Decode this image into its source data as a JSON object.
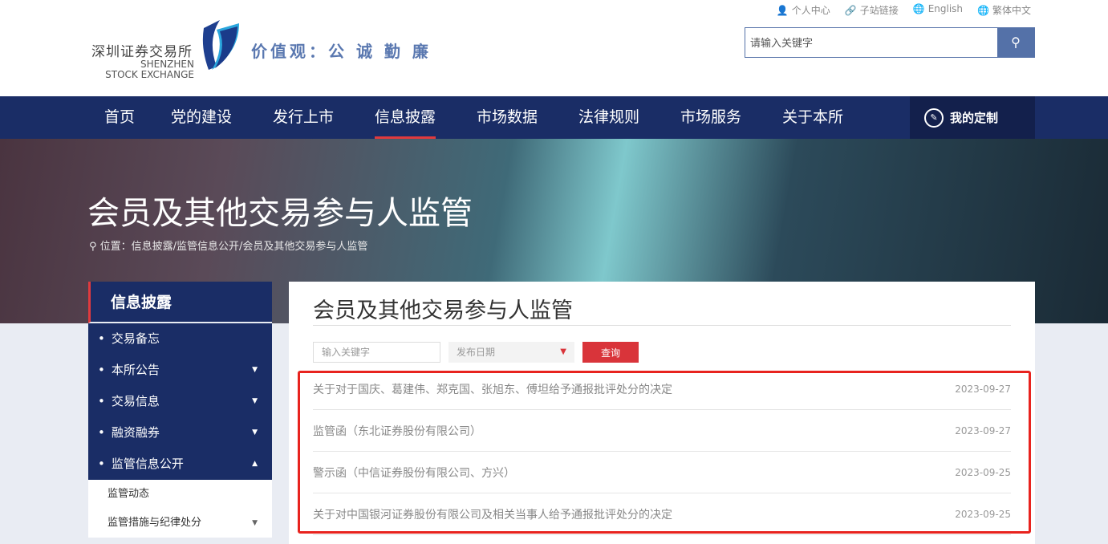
{
  "header": {
    "logo_cn": "深圳证券交易所",
    "logo_en_1": "SHENZHEN",
    "logo_en_2": "STOCK EXCHANGE",
    "slogan": "价值观：公 诚 勤 廉",
    "top_links": [
      {
        "icon": "user-icon",
        "label": "个人中心"
      },
      {
        "icon": "link-icon",
        "label": "子站链接"
      },
      {
        "icon": "globe-icon",
        "label": "English"
      },
      {
        "icon": "globe-icon",
        "label": "繁体中文"
      }
    ],
    "search_placeholder": "请输入关键字"
  },
  "nav": {
    "items": [
      "首页",
      "党的建设",
      "发行上市",
      "信息披露",
      "市场数据",
      "法律规则",
      "市场服务",
      "关于本所"
    ],
    "active": "信息披露",
    "custom": "我的定制"
  },
  "banner": {
    "title": "会员及其他交易参与人监管",
    "breadcrumb": "位置：信息披露/监管信息公开/会员及其他交易参与人监管"
  },
  "sidebar": {
    "title": "信息披露",
    "items": [
      {
        "label": "交易备忘"
      },
      {
        "label": "本所公告"
      },
      {
        "label": "交易信息"
      },
      {
        "label": "融资融券"
      },
      {
        "label": "监管信息公开"
      }
    ],
    "sub_items": [
      "监管动态",
      "监管措施与纪律处分"
    ]
  },
  "content": {
    "title": "会员及其他交易参与人监管",
    "keyword_placeholder": "输入关键字",
    "date_placeholder": "发布日期",
    "query": "查询",
    "rows": [
      {
        "title": "关于对于国庆、葛建伟、郑克国、张旭东、傅坦给予通报批评处分的决定",
        "date": "2023-09-27"
      },
      {
        "title": "监管函（东北证券股份有限公司）",
        "date": "2023-09-27"
      },
      {
        "title": "警示函（中信证券股份有限公司、方兴）",
        "date": "2023-09-25"
      },
      {
        "title": "关于对中国银河证券股份有限公司及相关当事人给予通报批评处分的决定",
        "date": "2023-09-25"
      }
    ]
  }
}
